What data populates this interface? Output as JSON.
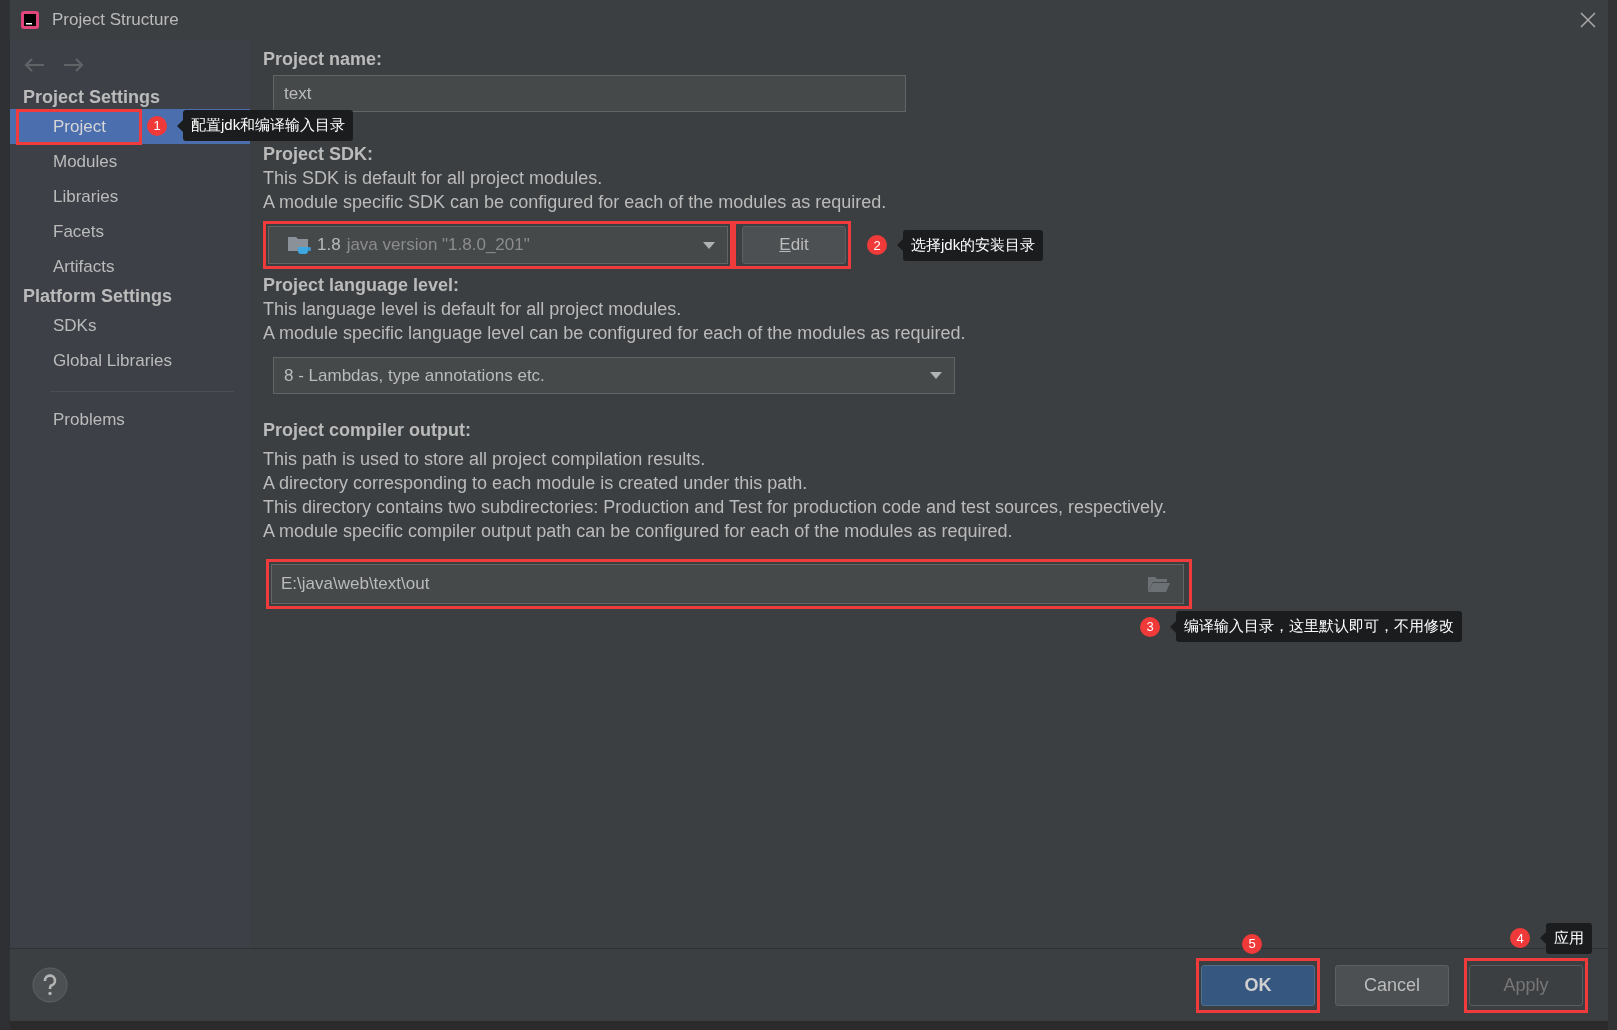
{
  "window": {
    "title": "Project Structure"
  },
  "sidebar": {
    "sections": [
      {
        "title": "Project Settings",
        "items": [
          {
            "label": "Project",
            "selected": true,
            "highlighted": true,
            "callout": {
              "number": "1",
              "text": "配置jdk和编译输入目录"
            }
          },
          {
            "label": "Modules",
            "selected": false,
            "highlighted": false
          },
          {
            "label": "Libraries",
            "selected": false,
            "highlighted": false
          },
          {
            "label": "Facets",
            "selected": false,
            "highlighted": false
          },
          {
            "label": "Artifacts",
            "selected": false,
            "highlighted": false
          }
        ]
      },
      {
        "title": "Platform Settings",
        "items": [
          {
            "label": "SDKs",
            "selected": false,
            "highlighted": false
          },
          {
            "label": "Global Libraries",
            "selected": false,
            "highlighted": false
          }
        ]
      }
    ],
    "bottom_items": [
      {
        "label": "Problems",
        "selected": false,
        "highlighted": false
      }
    ]
  },
  "project_name": {
    "label": "Project name:",
    "value": "text"
  },
  "sdk": {
    "label": "Project SDK:",
    "descriptions": [
      "This SDK is default for all project modules.",
      "A module specific SDK can be configured for each of the modules as required."
    ],
    "version": "1.8",
    "detail": "java version \"1.8.0_201\"",
    "highlighted": true,
    "edit_button": {
      "label": "Edit",
      "highlighted": true,
      "callout": {
        "number": "2",
        "text": "选择jdk的安装目录"
      }
    }
  },
  "language_level": {
    "label": "Project language level:",
    "descriptions": [
      "This language level is default for all project modules.",
      "A module specific language level can be configured for each of the modules as required."
    ],
    "value": "8 - Lambdas, type annotations etc."
  },
  "compiler_output": {
    "label": "Project compiler output:",
    "descriptions": [
      "This path is used to store all project compilation results.",
      "A directory corresponding to each module is created under this path.",
      "This directory contains two subdirectories: Production and Test for production code and test sources, respectively.",
      "A module specific compiler output path can be configured for each of the modules as required."
    ],
    "value": "E:\\java\\web\\text\\out",
    "highlighted": true,
    "callout": {
      "number": "3",
      "text": "编译输入目录，这里默认即可，不用修改"
    }
  },
  "buttons": [
    {
      "label": "OK",
      "kind": "primary",
      "highlighted": true,
      "disabled": false,
      "callout": {
        "number": "5"
      }
    },
    {
      "label": "Cancel",
      "kind": "normal",
      "highlighted": false,
      "disabled": false
    },
    {
      "label": "Apply",
      "kind": "normal",
      "highlighted": true,
      "disabled": true,
      "callout": {
        "number": "4",
        "text": "应用"
      }
    }
  ]
}
